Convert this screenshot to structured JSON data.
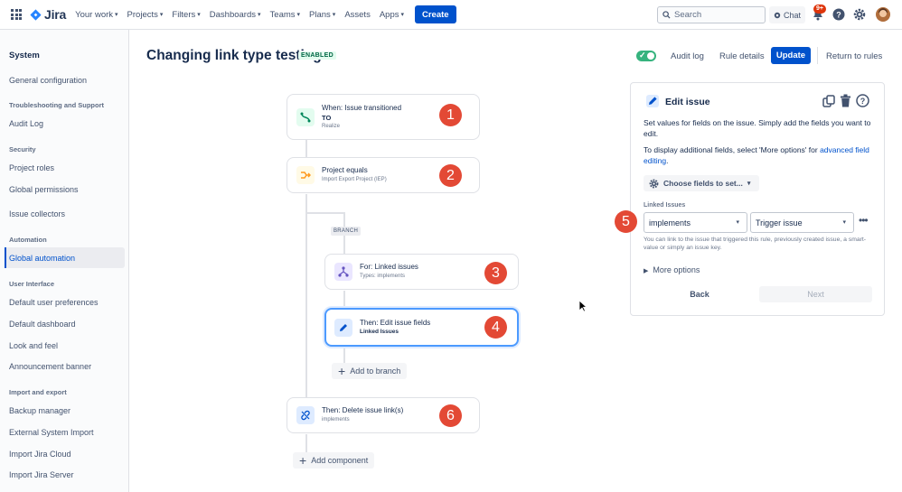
{
  "topnav": {
    "app_name": "Jira",
    "items": [
      {
        "label": "Your work",
        "chevron": true
      },
      {
        "label": "Projects",
        "chevron": true
      },
      {
        "label": "Filters",
        "chevron": true
      },
      {
        "label": "Dashboards",
        "chevron": true
      },
      {
        "label": "Teams",
        "chevron": true
      },
      {
        "label": "Plans",
        "chevron": true
      },
      {
        "label": "Assets",
        "chevron": false
      },
      {
        "label": "Apps",
        "chevron": true
      }
    ],
    "create_label": "Create",
    "search_placeholder": "Search",
    "chat_label": "Chat",
    "notifications_badge": "9+"
  },
  "sidebar": {
    "title": "System",
    "sections": [
      {
        "heading": "",
        "items": [
          "General configuration"
        ]
      },
      {
        "heading": "Troubleshooting and Support",
        "items": [
          "Audit Log"
        ]
      },
      {
        "heading": "Security",
        "items": [
          "Project roles",
          "Global permissions",
          "Issue collectors"
        ]
      },
      {
        "heading": "Automation",
        "items": [
          "Global automation"
        ]
      },
      {
        "heading": "User Interface",
        "items": [
          "Default user preferences",
          "Default dashboard",
          "Look and feel",
          "Announcement banner"
        ]
      },
      {
        "heading": "Import and export",
        "items": [
          "Backup manager",
          "External System Import",
          "Import Jira Cloud",
          "Import Jira Server"
        ]
      }
    ],
    "active_item": "Global automation"
  },
  "header": {
    "title": "Changing link type testing",
    "status": "ENABLED",
    "audit_log": "Audit log",
    "rule_details": "Rule details",
    "update": "Update",
    "return": "Return to rules"
  },
  "flow": {
    "trigger": {
      "title": "When: Issue transitioned",
      "line2": "TO",
      "line3": "Realize",
      "number": "1"
    },
    "condition": {
      "title": "Project equals",
      "sub": "Import Export Project (IEP)",
      "number": "2"
    },
    "branch_label": "BRANCH",
    "branch_for": {
      "title": "For: Linked issues",
      "sub": "Types: implements",
      "number": "3"
    },
    "branch_then": {
      "title": "Then: Edit issue fields",
      "sub": "Linked Issues",
      "number": "4"
    },
    "add_to_branch": "Add to branch",
    "delete_action": {
      "title": "Then: Delete issue link(s)",
      "sub": "implements",
      "number": "6"
    },
    "add_component": "Add component"
  },
  "panel": {
    "title": "Edit issue",
    "desc1": "Set values for fields on the issue. Simply add the fields you want to edit.",
    "desc2_prefix": "To display additional fields, select 'More options' for ",
    "desc2_link": "advanced field editing",
    "desc2_suffix": ".",
    "choose_fields": "Choose fields to set...",
    "field_label": "Linked Issues",
    "link_type_value": "implements",
    "issue_value": "Trigger issue",
    "marker_number": "5",
    "helper": "You can link to the issue that triggered this rule, previously created issue, a smart-value or simply an issue key.",
    "more_options": "More options",
    "back": "Back",
    "next": "Next"
  },
  "colors": {
    "primary": "#0052cc",
    "marker": "#e34935",
    "enabled": "#36b37e",
    "selected_border": "#4c9aff"
  }
}
